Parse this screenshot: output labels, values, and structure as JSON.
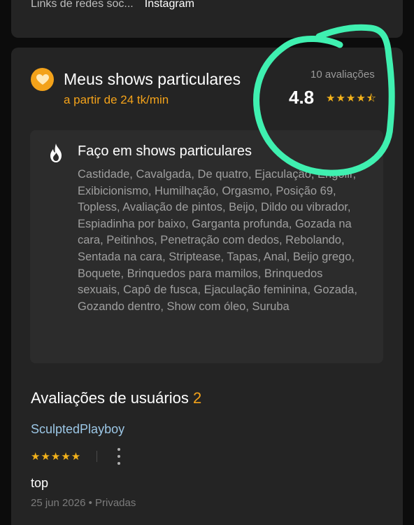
{
  "social": {
    "label": "Links de redes soc...",
    "value": "Instagram"
  },
  "show": {
    "icon": "heart-icon",
    "title": "Meus shows particulares",
    "price": "a partir de 24 tk/min",
    "rating_count": "10 avaliações",
    "rating_value": "4.8",
    "rating_stars": "★★★★⯪"
  },
  "private_shows": {
    "icon": "fire-icon",
    "title": "Faço em shows particulares",
    "list": "Castidade, Cavalgada, De quatro, Ejaculação, Engolir, Exibicionismo, Humilhação, Orgasmo, Posição 69, Topless, Avaliação de pintos, Beijo, Dildo ou vibrador, Espiadinha por baixo, Garganta profunda, Gozada na cara, Peitinhos, Penetração com dedos, Rebolando, Sentada na cara, Striptease, Tapas, Anal, Beijo grego, Boquete, Brinquedos para mamilos, Brinquedos sexuais, Capô de fusca, Ejaculação feminina, Gozada, Gozando dentro, Show com óleo, Suruba"
  },
  "reviews": {
    "title": "Avaliações de usuários",
    "count": "2",
    "items": [
      {
        "author": "SculptedPlayboy",
        "stars": "★★★★★",
        "text": "top",
        "meta": "25 jun 2026 • Privadas"
      }
    ]
  },
  "annotation": {
    "color": "#3ff0b0"
  }
}
